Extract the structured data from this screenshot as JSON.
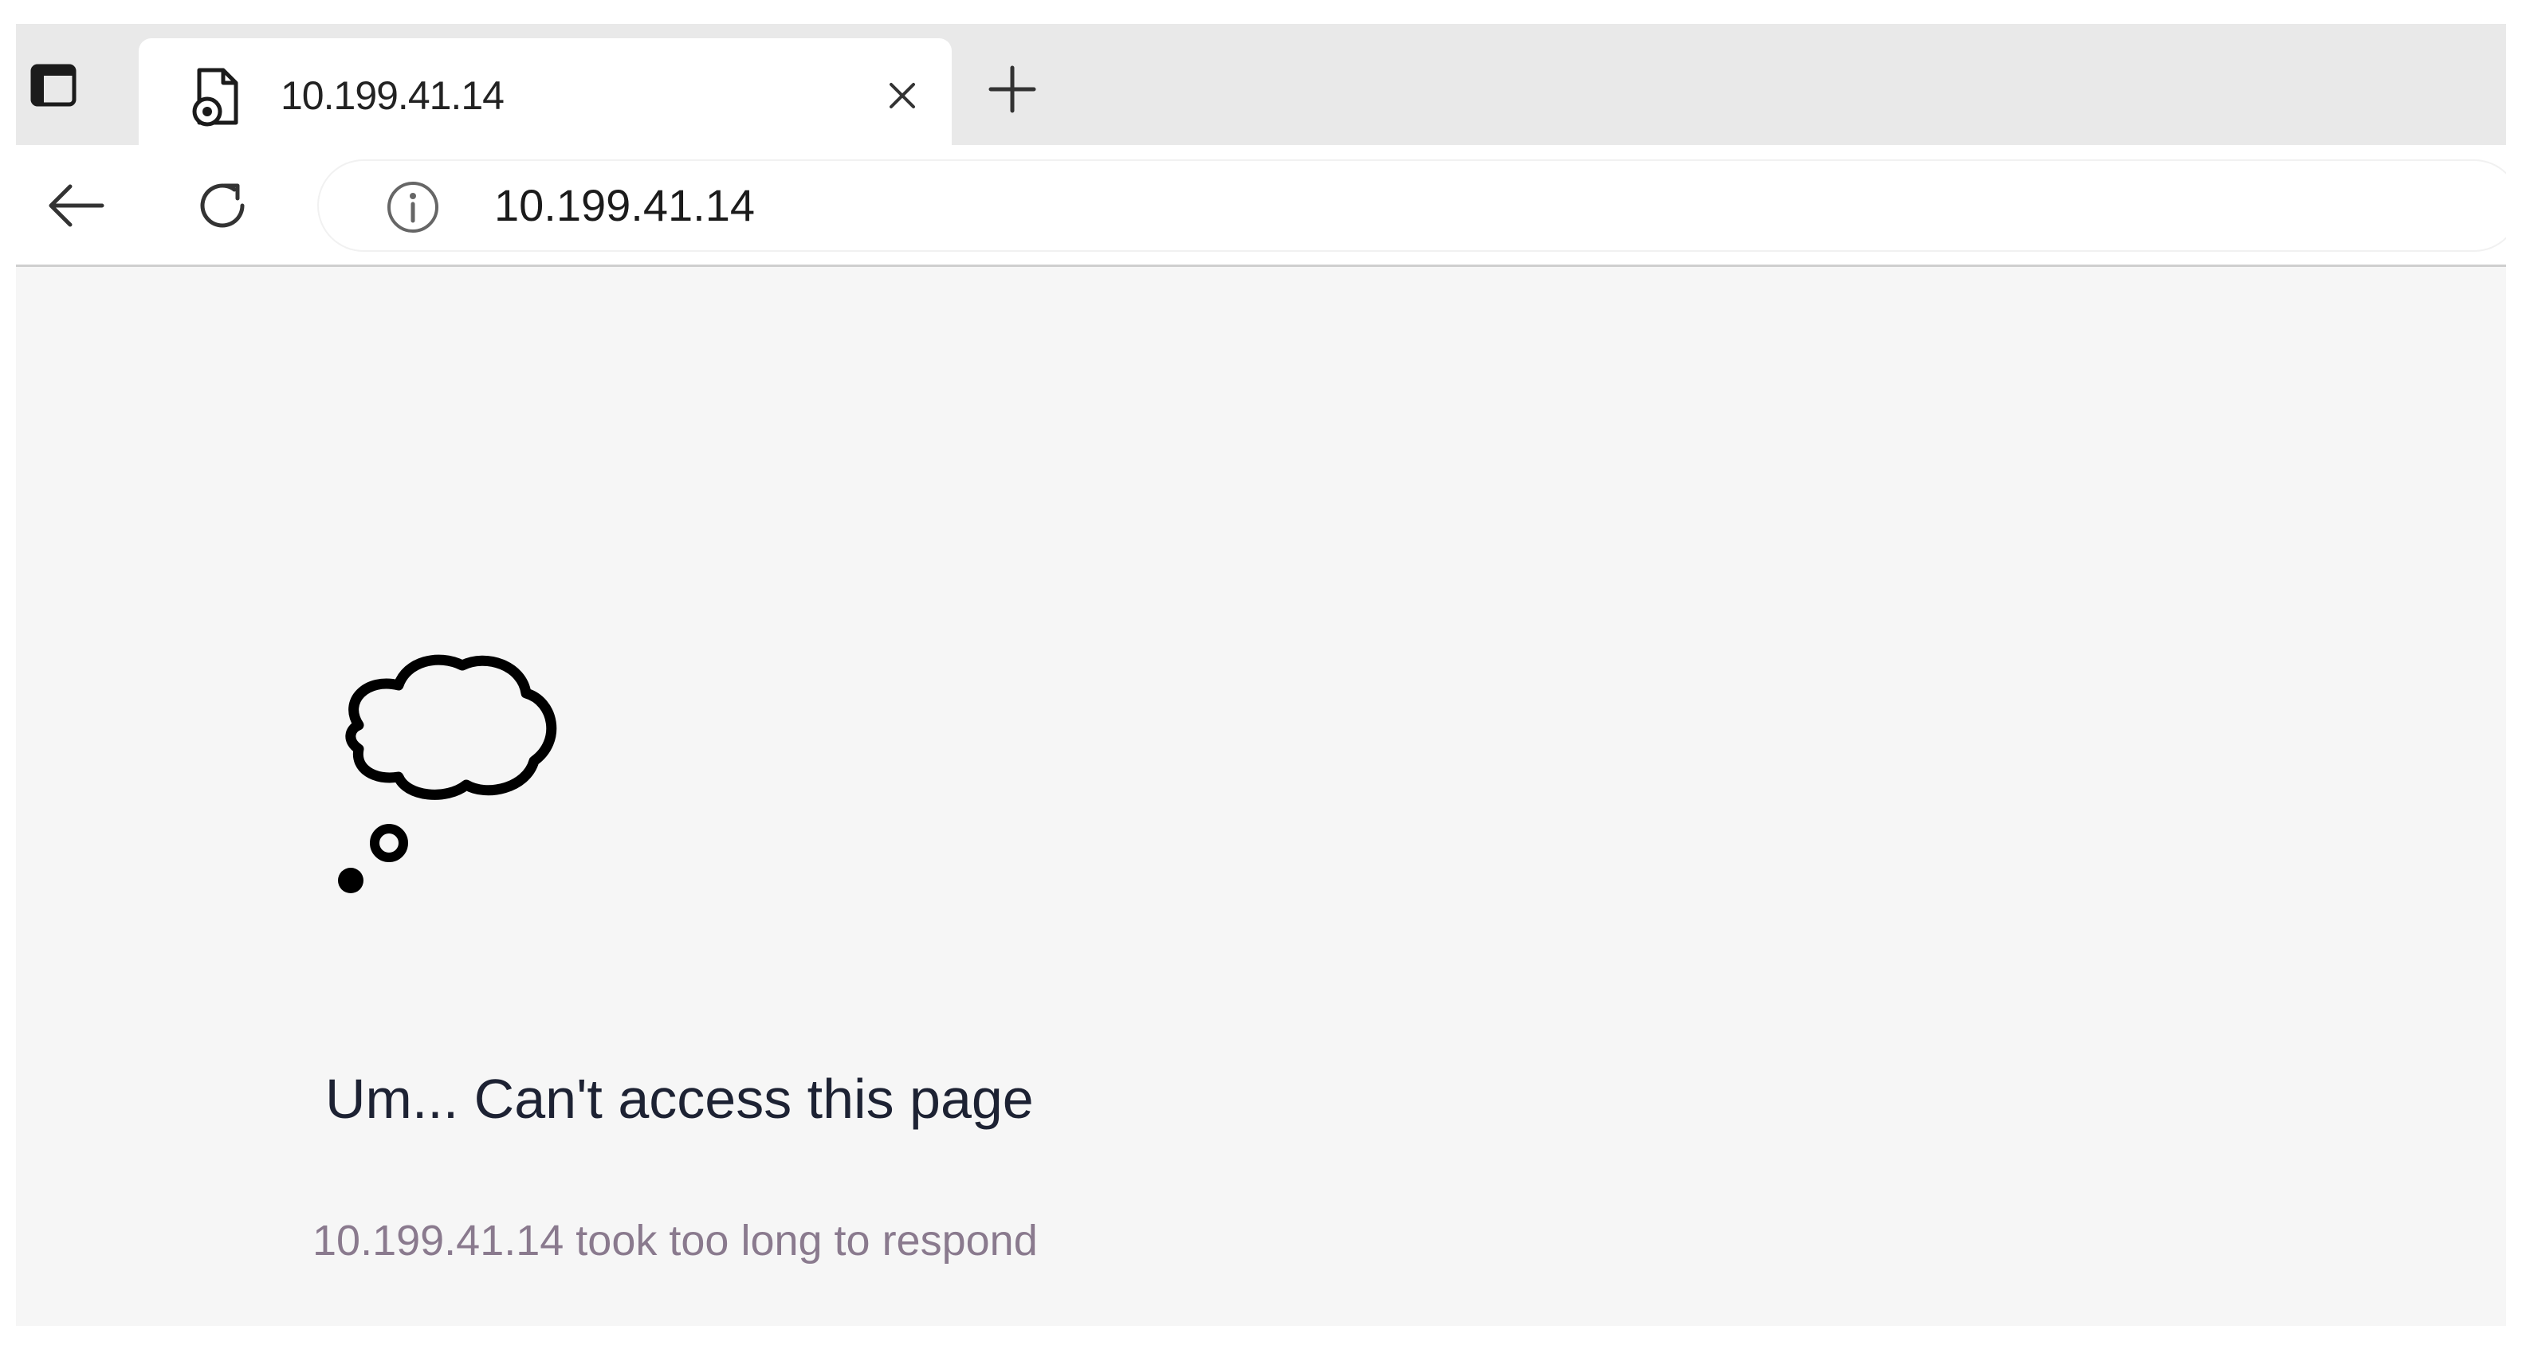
{
  "tab_strip": {
    "tab_actions_icon": "tab-actions-icon",
    "tabs": [
      {
        "title": "10.199.41.14",
        "favicon": "document-error-icon",
        "close_icon": "close-icon"
      }
    ],
    "new_tab_icon": "plus-icon"
  },
  "toolbar": {
    "back_icon": "arrow-left-icon",
    "reload_icon": "refresh-icon",
    "site_info_icon": "info-icon",
    "address": "10.199.41.14"
  },
  "error_page": {
    "icon": "thought-cloud-icon",
    "heading": "Um... Can't access this page",
    "detail": "10.199.41.14 took too long to respond"
  },
  "colors": {
    "page_background": "#f6f6f6",
    "tabstrip_background": "#e9e9e9",
    "heading_text": "#1d2233",
    "detail_text": "#8a7a8e"
  }
}
